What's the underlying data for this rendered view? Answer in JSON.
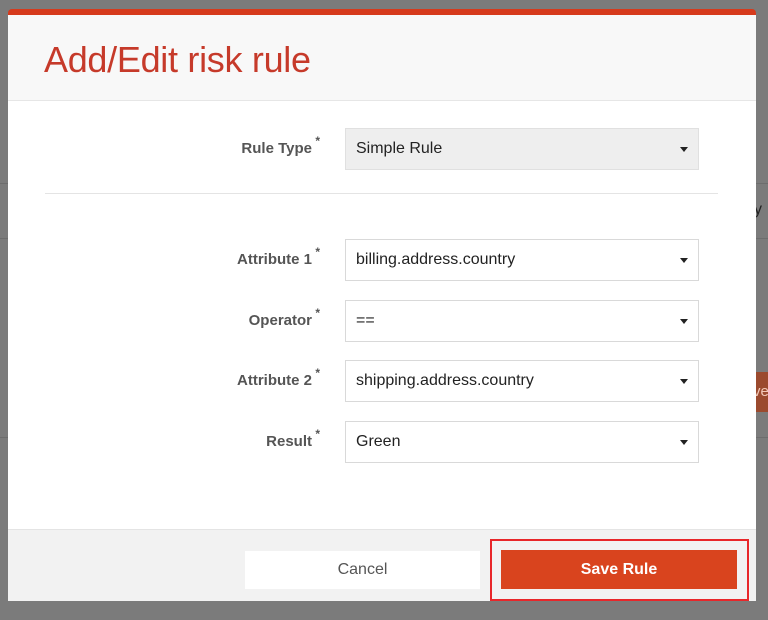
{
  "background": {
    "partial_text": "y",
    "partial_button_text": "ve"
  },
  "modal": {
    "title": "Add/Edit risk rule",
    "accent_color": "#d63a1c",
    "required_marker": "*",
    "rule_type": {
      "label": "Rule Type",
      "value": "Simple Rule"
    },
    "fields": [
      {
        "label": "Attribute 1",
        "value": "billing.address.country"
      },
      {
        "label": "Operator",
        "value": "=="
      },
      {
        "label": "Attribute 2",
        "value": "shipping.address.country"
      },
      {
        "label": "Result",
        "value": "Green"
      }
    ],
    "footer": {
      "cancel_label": "Cancel",
      "save_label": "Save Rule",
      "save_color": "#d9441e",
      "highlight_color": "#e8272a"
    }
  }
}
